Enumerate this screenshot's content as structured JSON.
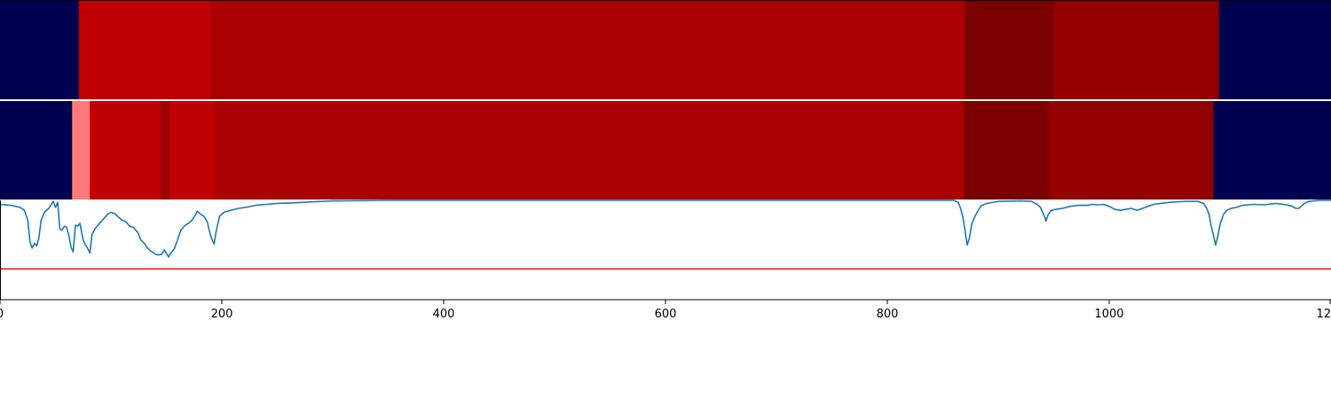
{
  "chart_data": [
    {
      "type": "heatmap",
      "name": "segment-track-1",
      "xlim": [
        0,
        1200
      ],
      "segments": [
        {
          "start": 0,
          "end": 71,
          "color": "#000050"
        },
        {
          "start": 71,
          "end": 190,
          "color": "#c00000"
        },
        {
          "start": 190,
          "end": 870,
          "color": "#ab0000"
        },
        {
          "start": 870,
          "end": 950,
          "color": "#7a0000"
        },
        {
          "start": 950,
          "end": 1099,
          "color": "#930000"
        },
        {
          "start": 1099,
          "end": 1200,
          "color": "#000050"
        }
      ]
    },
    {
      "type": "heatmap",
      "name": "segment-track-2",
      "xlim": [
        0,
        1200
      ],
      "segments": [
        {
          "start": 0,
          "end": 65,
          "color": "#000050"
        },
        {
          "start": 65,
          "end": 81,
          "color": "#ff7b7b"
        },
        {
          "start": 81,
          "end": 145,
          "color": "#c00000"
        },
        {
          "start": 145,
          "end": 153,
          "color": "#9a0000"
        },
        {
          "start": 153,
          "end": 193,
          "color": "#c00000"
        },
        {
          "start": 193,
          "end": 869,
          "color": "#ab0000"
        },
        {
          "start": 869,
          "end": 945,
          "color": "#7a0000"
        },
        {
          "start": 945,
          "end": 1094,
          "color": "#930000"
        },
        {
          "start": 1094,
          "end": 1200,
          "color": "#000050"
        }
      ]
    },
    {
      "type": "line",
      "xlim": [
        0,
        1200
      ],
      "ylim": [
        0,
        1
      ],
      "xticks": [
        "0",
        "200",
        "400",
        "600",
        "800",
        "1000",
        "1200"
      ],
      "xtick_values": [
        0,
        200,
        400,
        600,
        800,
        1000,
        1200
      ],
      "threshold": {
        "value": 0.31,
        "color": "#e41a1c"
      },
      "series": [
        {
          "color": "#1f77b4",
          "points": [
            [
              0,
              0.96
            ],
            [
              10,
              0.95
            ],
            [
              18,
              0.93
            ],
            [
              22,
              0.9
            ],
            [
              25,
              0.8
            ],
            [
              27,
              0.58
            ],
            [
              29,
              0.52
            ],
            [
              31,
              0.57
            ],
            [
              33,
              0.54
            ],
            [
              35,
              0.62
            ],
            [
              37,
              0.8
            ],
            [
              40,
              0.88
            ],
            [
              44,
              0.92
            ],
            [
              48,
              0.99
            ],
            [
              50,
              0.93
            ],
            [
              52,
              0.98
            ],
            [
              54,
              0.71
            ],
            [
              56,
              0.7
            ],
            [
              58,
              0.74
            ],
            [
              60,
              0.73
            ],
            [
              62,
              0.65
            ],
            [
              64,
              0.53
            ],
            [
              66,
              0.48
            ],
            [
              68,
              0.75
            ],
            [
              70,
              0.74
            ],
            [
              72,
              0.77
            ],
            [
              75,
              0.6
            ],
            [
              77,
              0.55
            ],
            [
              79,
              0.52
            ],
            [
              81,
              0.47
            ],
            [
              83,
              0.66
            ],
            [
              86,
              0.72
            ],
            [
              89,
              0.76
            ],
            [
              93,
              0.81
            ],
            [
              97,
              0.86
            ],
            [
              100,
              0.88
            ],
            [
              103,
              0.87
            ],
            [
              106,
              0.84
            ],
            [
              110,
              0.8
            ],
            [
              113,
              0.79
            ],
            [
              117,
              0.74
            ],
            [
              120,
              0.73
            ],
            [
              124,
              0.68
            ],
            [
              127,
              0.6
            ],
            [
              130,
              0.57
            ],
            [
              133,
              0.52
            ],
            [
              136,
              0.49
            ],
            [
              140,
              0.46
            ],
            [
              143,
              0.45
            ],
            [
              146,
              0.46
            ],
            [
              148,
              0.5
            ],
            [
              150,
              0.47
            ],
            [
              152,
              0.43
            ],
            [
              154,
              0.47
            ],
            [
              157,
              0.51
            ],
            [
              160,
              0.6
            ],
            [
              163,
              0.7
            ],
            [
              166,
              0.74
            ],
            [
              170,
              0.77
            ],
            [
              173,
              0.8
            ],
            [
              176,
              0.85
            ],
            [
              178,
              0.89
            ],
            [
              181,
              0.86
            ],
            [
              184,
              0.84
            ],
            [
              187,
              0.78
            ],
            [
              189,
              0.68
            ],
            [
              191,
              0.61
            ],
            [
              193,
              0.56
            ],
            [
              195,
              0.7
            ],
            [
              198,
              0.84
            ],
            [
              202,
              0.88
            ],
            [
              208,
              0.9
            ],
            [
              215,
              0.92
            ],
            [
              222,
              0.93
            ],
            [
              230,
              0.95
            ],
            [
              240,
              0.96
            ],
            [
              250,
              0.97
            ],
            [
              265,
              0.975
            ],
            [
              280,
              0.985
            ],
            [
              300,
              0.995
            ],
            [
              350,
              1.0
            ],
            [
              500,
              1.0
            ],
            [
              700,
              1.0
            ],
            [
              860,
              1.0
            ],
            [
              864,
              0.98
            ],
            [
              866,
              0.92
            ],
            [
              868,
              0.84
            ],
            [
              870,
              0.7
            ],
            [
              871,
              0.62
            ],
            [
              872,
              0.55
            ],
            [
              874,
              0.62
            ],
            [
              876,
              0.76
            ],
            [
              879,
              0.84
            ],
            [
              881,
              0.88
            ],
            [
              883,
              0.92
            ],
            [
              885,
              0.95
            ],
            [
              890,
              0.97
            ],
            [
              900,
              0.99
            ],
            [
              920,
              0.995
            ],
            [
              930,
              0.99
            ],
            [
              935,
              0.96
            ],
            [
              938,
              0.93
            ],
            [
              940,
              0.88
            ],
            [
              942,
              0.83
            ],
            [
              943,
              0.79
            ],
            [
              945,
              0.86
            ],
            [
              948,
              0.9
            ],
            [
              952,
              0.91
            ],
            [
              958,
              0.92
            ],
            [
              965,
              0.94
            ],
            [
              972,
              0.95
            ],
            [
              980,
              0.95
            ],
            [
              985,
              0.96
            ],
            [
              990,
              0.955
            ],
            [
              995,
              0.96
            ],
            [
              1000,
              0.94
            ],
            [
              1005,
              0.91
            ],
            [
              1010,
              0.9
            ],
            [
              1015,
              0.91
            ],
            [
              1020,
              0.92
            ],
            [
              1025,
              0.9
            ],
            [
              1030,
              0.92
            ],
            [
              1035,
              0.94
            ],
            [
              1040,
              0.96
            ],
            [
              1050,
              0.975
            ],
            [
              1060,
              0.985
            ],
            [
              1070,
              0.99
            ],
            [
              1080,
              0.99
            ],
            [
              1085,
              0.97
            ],
            [
              1088,
              0.92
            ],
            [
              1090,
              0.86
            ],
            [
              1092,
              0.74
            ],
            [
              1094,
              0.65
            ],
            [
              1096,
              0.55
            ],
            [
              1098,
              0.64
            ],
            [
              1100,
              0.76
            ],
            [
              1103,
              0.86
            ],
            [
              1106,
              0.9
            ],
            [
              1110,
              0.92
            ],
            [
              1115,
              0.93
            ],
            [
              1120,
              0.95
            ],
            [
              1130,
              0.96
            ],
            [
              1140,
              0.955
            ],
            [
              1150,
              0.97
            ],
            [
              1160,
              0.955
            ],
            [
              1165,
              0.94
            ],
            [
              1168,
              0.92
            ],
            [
              1171,
              0.92
            ],
            [
              1173,
              0.94
            ],
            [
              1176,
              0.97
            ],
            [
              1180,
              0.99
            ],
            [
              1190,
              1.0
            ],
            [
              1200,
              1.0
            ]
          ]
        }
      ]
    }
  ]
}
